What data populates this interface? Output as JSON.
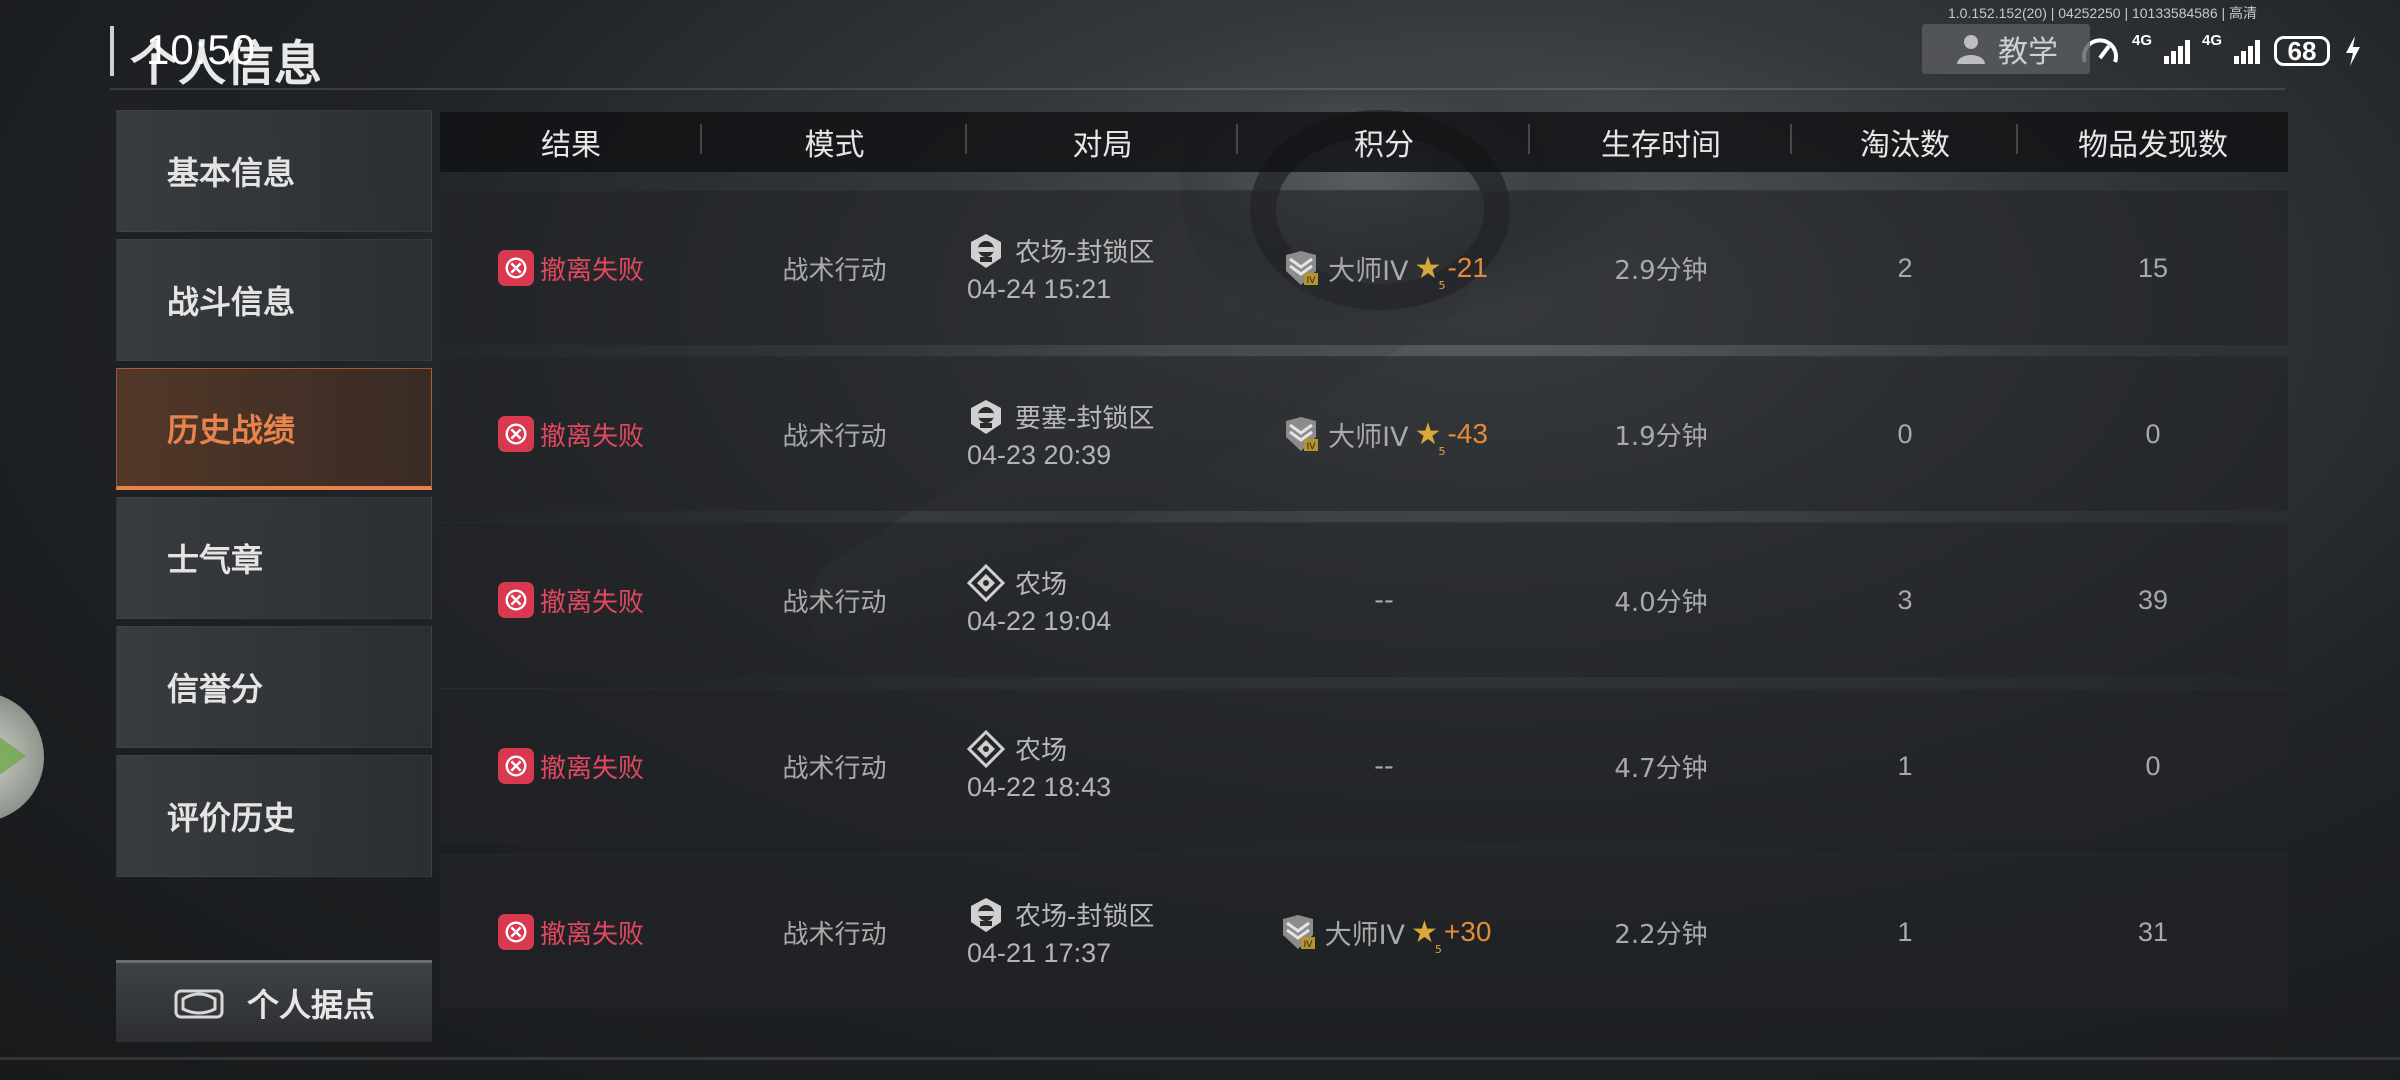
{
  "status_bar": {
    "time": "10:50",
    "version_text": "1.0.152.152(20) | 04252250 | 10133584586 | 高清",
    "net_1": "4G",
    "net_2": "4G",
    "battery": "68"
  },
  "header": {
    "title": "个人信息",
    "tutorial_label": "教学"
  },
  "sidebar": {
    "items": [
      {
        "label": "基本信息"
      },
      {
        "label": "战斗信息"
      },
      {
        "label": "历史战绩"
      },
      {
        "label": "士气章"
      },
      {
        "label": "信誉分"
      },
      {
        "label": "评价历史"
      }
    ],
    "active_index": 2,
    "base_button": "个人据点"
  },
  "table": {
    "headers": [
      "结果",
      "模式",
      "对局",
      "积分",
      "生存时间",
      "淘汰数",
      "物品发现数"
    ],
    "rows": [
      {
        "result": "撤离失败",
        "mode": "战术行动",
        "map": "农场-封锁区",
        "datetime": "04-24 15:21",
        "map_icon": "helmet-icon",
        "rank": "大师IV",
        "delta": "-21",
        "score": "",
        "survive": "2.9分钟",
        "kills": "2",
        "items": "15"
      },
      {
        "result": "撤离失败",
        "mode": "战术行动",
        "map": "要塞-封锁区",
        "datetime": "04-23 20:39",
        "map_icon": "helmet-icon",
        "rank": "大师IV",
        "delta": "-43",
        "score": "",
        "survive": "1.9分钟",
        "kills": "0",
        "items": "0"
      },
      {
        "result": "撤离失败",
        "mode": "战术行动",
        "map": "农场",
        "datetime": "04-22 19:04",
        "map_icon": "diamond-crosshair-icon",
        "rank": "",
        "delta": "",
        "score": "--",
        "survive": "4.0分钟",
        "kills": "3",
        "items": "39"
      },
      {
        "result": "撤离失败",
        "mode": "战术行动",
        "map": "农场",
        "datetime": "04-22 18:43",
        "map_icon": "diamond-crosshair-icon",
        "rank": "",
        "delta": "",
        "score": "--",
        "survive": "4.7分钟",
        "kills": "1",
        "items": "0"
      },
      {
        "result": "撤离失败",
        "mode": "战术行动",
        "map": "农场-封锁区",
        "datetime": "04-21 17:37",
        "map_icon": "helmet-icon",
        "rank": "大师IV",
        "delta": "+30",
        "score": "",
        "survive": "2.2分钟",
        "kills": "1",
        "items": "31"
      }
    ]
  },
  "colors": {
    "accent_orange": "#e7834c",
    "fail_red": "#e0485f",
    "delta_orange": "#e58a3c",
    "star_gold": "#d6a93a"
  }
}
